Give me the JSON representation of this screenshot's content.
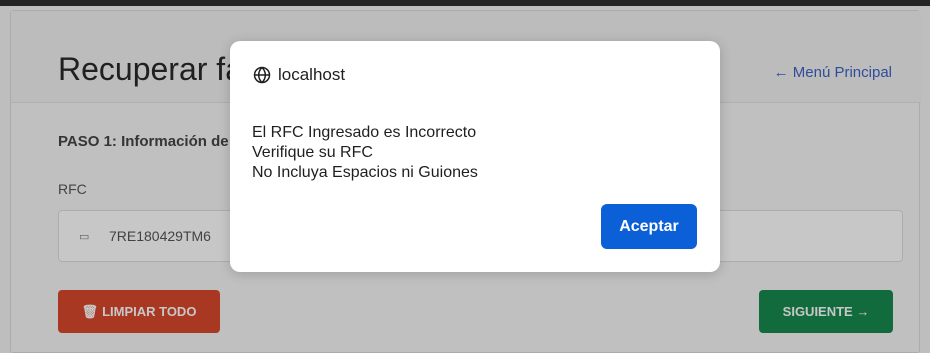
{
  "page": {
    "title": "Recuperar fa",
    "menu_link": "← Menú Principal",
    "step_title": "PASO 1: Información de",
    "rfc_label": "RFC",
    "rfc_value": "7RE180429TM6",
    "clear_button": "LIMPIAR TODO",
    "next_button": "SIGUIENTE →"
  },
  "dialog": {
    "title": "localhost",
    "message_lines": [
      "El RFC Ingresado es Incorrecto",
      "Verifique su RFC",
      "No Incluya Espacios ni Guiones"
    ],
    "accept_button": "Aceptar"
  },
  "icons": {
    "dialog_title_icon": "globe-icon",
    "rfc_icon": "id-card-icon",
    "clear_button_icon": "trash-icon"
  },
  "colors": {
    "menu_link": "#3d63c8",
    "clear_button": "#d9482d",
    "next_button": "#178a4f",
    "accept_button": "#0b5fd7"
  }
}
